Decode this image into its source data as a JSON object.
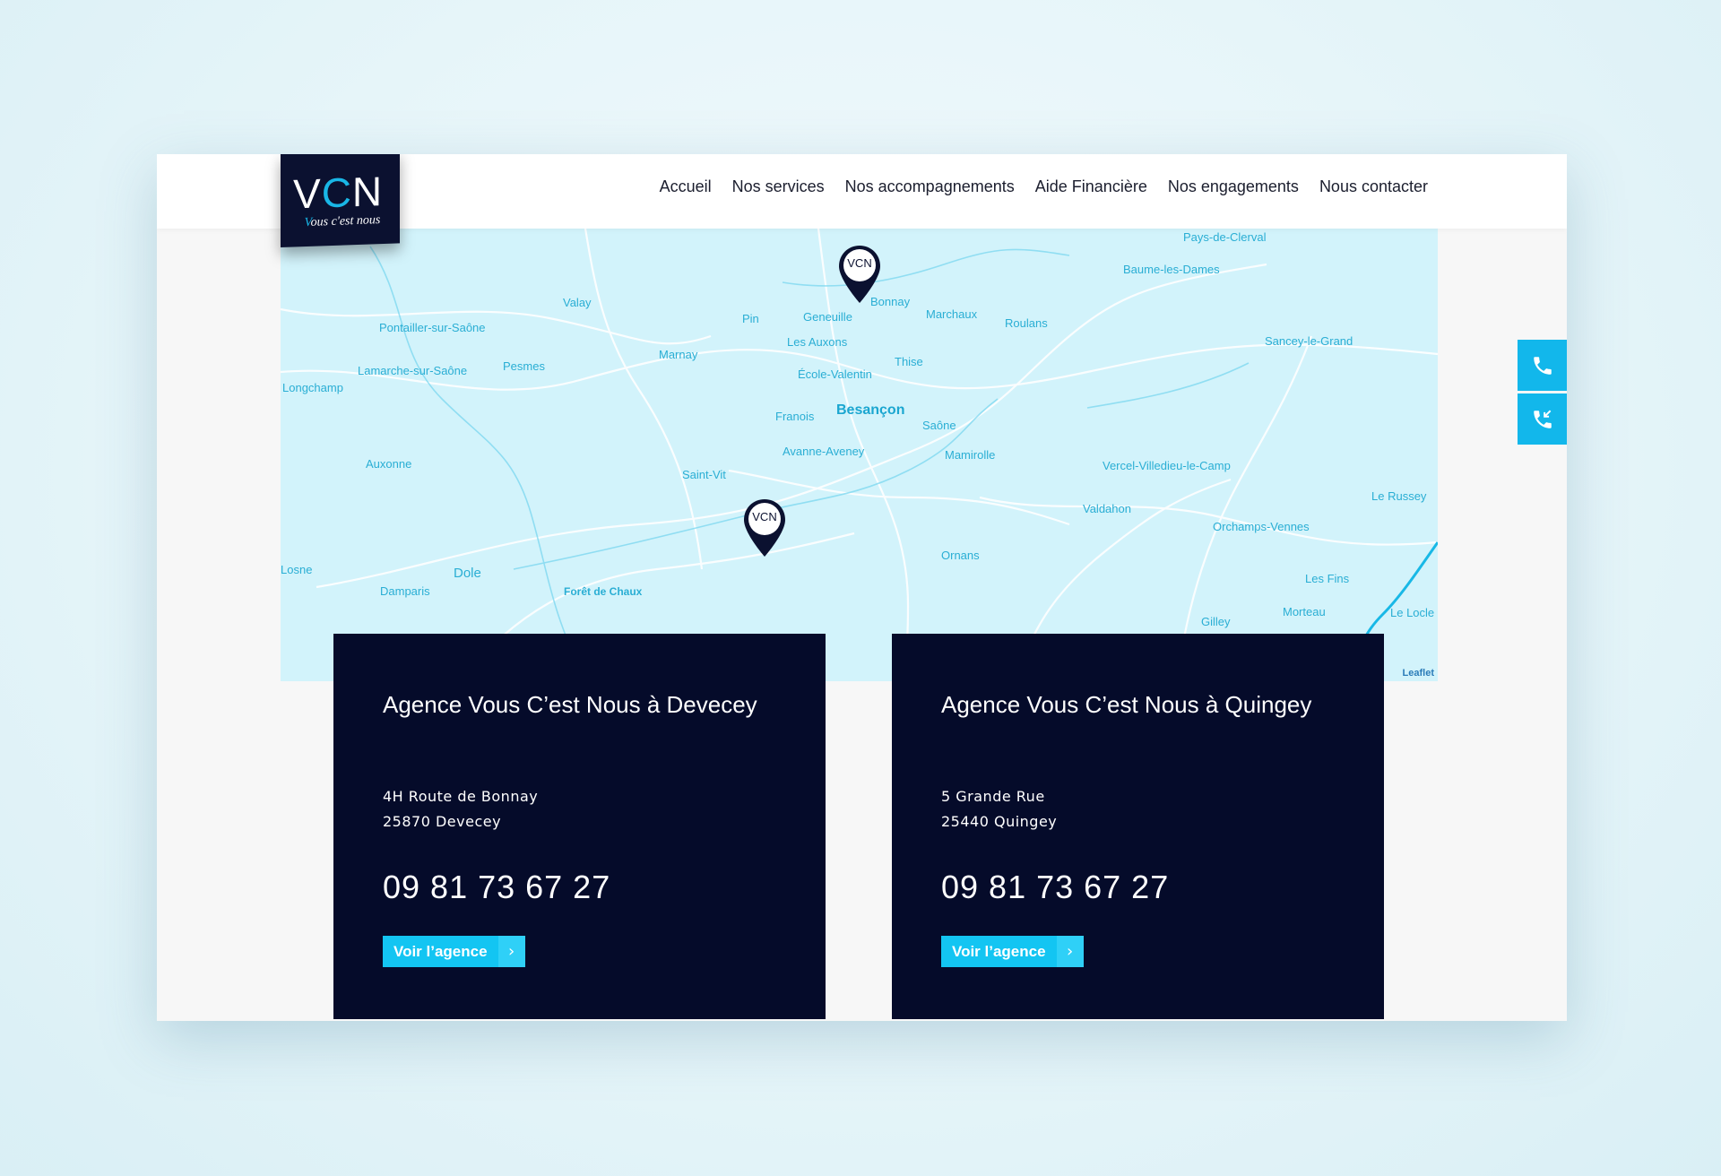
{
  "logo": {
    "letters_v": "V",
    "letters_c": "C",
    "letters_n": "N",
    "tagline_v": "V",
    "tagline_rest": "ous c'est nous"
  },
  "nav": [
    "Accueil",
    "Nos services",
    "Nos accompagnements",
    "Aide Financière",
    "Nos engagements",
    "Nous contacter"
  ],
  "map": {
    "labels": [
      "Pays-de-Clerval",
      "Baume-les-Dames",
      "Valay",
      "Bonnay",
      "Geneuille",
      "Pin",
      "Marchaux",
      "Roulans",
      "Pontailler-sur-Saône",
      "Pesmes",
      "Marnay",
      "Les Auxons",
      "Thise",
      "Sancey-le-Grand",
      "Lamarche-sur-Saône",
      "Longchamp",
      "École-Valentin",
      "Besançon",
      "Franois",
      "Saône",
      "Avanne-Aveney",
      "Mamirolle",
      "Auxonne",
      "Saint-Vit",
      "Vercel-Villedieu-le-Camp",
      "Valdahon",
      "Le Russey",
      "Orchamps-Vennes",
      "Ornans",
      "Dole",
      "Forêt de Chaux",
      "Les Fins",
      "Damparis",
      "Morteau",
      "Le Locle",
      "Gilley",
      "Losne"
    ],
    "attribution": "Leaflet",
    "pin_text": "VCN"
  },
  "agencies": [
    {
      "title": "Agence Vous C’est Nous à Devecey",
      "address_line1": "4H Route de Bonnay",
      "address_line2": "25870 Devecey",
      "phone": "09 81 73 67 27",
      "button": "Voir l’agence"
    },
    {
      "title": "Agence Vous C’est Nous à Quingey",
      "address_line1": "5 Grande Rue",
      "address_line2": "25440 Quingey",
      "phone": "09 81 73 67 27",
      "button": "Voir l’agence"
    }
  ],
  "side_buttons": [
    "phone-icon",
    "phone-callback-icon"
  ],
  "colors": {
    "navy": "#050b2a",
    "accent": "#13c5f2",
    "map_water": "#d2f3fb"
  }
}
